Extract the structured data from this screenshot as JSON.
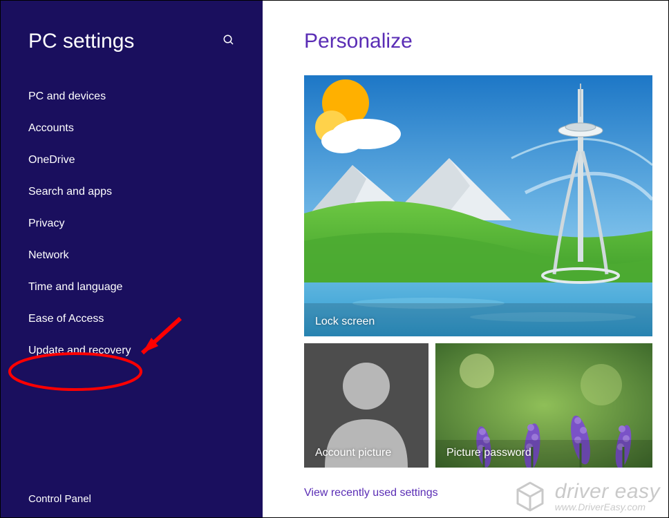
{
  "sidebar": {
    "title": "PC settings",
    "items": [
      "PC and devices",
      "Accounts",
      "OneDrive",
      "Search and apps",
      "Privacy",
      "Network",
      "Time and language",
      "Ease of Access",
      "Update and recovery"
    ],
    "footer_link": "Control Panel"
  },
  "main": {
    "title": "Personalize",
    "tiles": {
      "lock_screen_label": "Lock screen",
      "account_picture_label": "Account picture",
      "picture_password_label": "Picture password"
    },
    "recent_link": "View recently used settings"
  },
  "annotation": {
    "highlighted_item": "Update and recovery"
  },
  "watermark": {
    "brand": "driver easy",
    "url": "www.DriverEasy.com"
  },
  "colors": {
    "sidebar_bg": "#1a0f5e",
    "accent": "#5a2db5",
    "annotation": "#ff0000"
  }
}
